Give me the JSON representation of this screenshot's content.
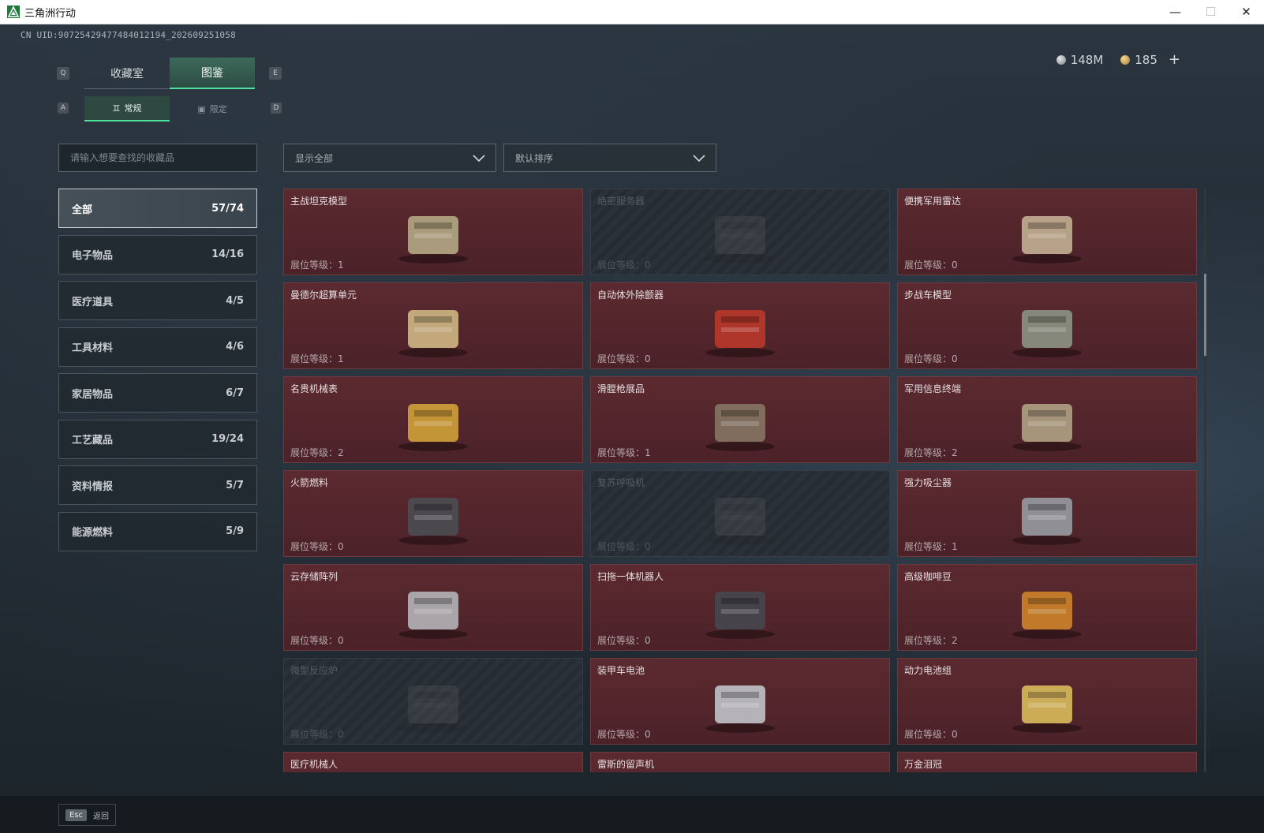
{
  "window": {
    "title": "三角洲行动"
  },
  "uid": "CN UID:9072542947748401219​4_202609251058",
  "currency": {
    "silver": "148M",
    "gold": "185"
  },
  "key_hints": {
    "q": "Q",
    "e": "E",
    "a": "A",
    "d": "D"
  },
  "main_tabs": [
    {
      "label": "收藏室",
      "active": false
    },
    {
      "label": "图鉴",
      "active": true
    }
  ],
  "sub_tabs": [
    {
      "label": "常规",
      "active": true
    },
    {
      "label": "限定",
      "active": false
    }
  ],
  "search": {
    "placeholder": "请输入想要查找的收藏品"
  },
  "filters": {
    "show": "显示全部",
    "sort": "默认排序"
  },
  "categories": [
    {
      "label": "全部",
      "count": "57/74",
      "active": true
    },
    {
      "label": "电子物品",
      "count": "14/16"
    },
    {
      "label": "医疗道具",
      "count": "4/5"
    },
    {
      "label": "工具材料",
      "count": "4/6"
    },
    {
      "label": "家居物品",
      "count": "6/7"
    },
    {
      "label": "工艺藏品",
      "count": "19/24"
    },
    {
      "label": "资料情报",
      "count": "5/7"
    },
    {
      "label": "能源燃料",
      "count": "5/9"
    }
  ],
  "level_label": "展位等级：",
  "items": [
    {
      "name": "主战坦克模型",
      "level": "1",
      "locked": false,
      "icon": "tank-model-icon"
    },
    {
      "name": "绝密服务器",
      "level": "0",
      "locked": true,
      "icon": "server-icon"
    },
    {
      "name": "便携军用雷达",
      "level": "0",
      "locked": false,
      "icon": "radar-icon"
    },
    {
      "name": "曼德尔超算单元",
      "level": "1",
      "locked": false,
      "icon": "cpu-unit-icon"
    },
    {
      "name": "自动体外除颤器",
      "level": "0",
      "locked": false,
      "icon": "defibrillator-icon"
    },
    {
      "name": "步战车模型",
      "level": "0",
      "locked": false,
      "icon": "ifv-model-icon"
    },
    {
      "name": "名贵机械表",
      "level": "2",
      "locked": false,
      "icon": "watch-icon"
    },
    {
      "name": "滑膛枪展品",
      "level": "1",
      "locked": false,
      "icon": "musket-icon"
    },
    {
      "name": "军用信息终端",
      "level": "2",
      "locked": false,
      "icon": "terminal-icon"
    },
    {
      "name": "火箭燃料",
      "level": "0",
      "locked": false,
      "icon": "fuel-can-icon"
    },
    {
      "name": "复苏呼吸机",
      "level": "0",
      "locked": true,
      "icon": "ventilator-icon"
    },
    {
      "name": "强力吸尘器",
      "level": "1",
      "locked": false,
      "icon": "vacuum-icon"
    },
    {
      "name": "云存储阵列",
      "level": "0",
      "locked": false,
      "icon": "storage-array-icon"
    },
    {
      "name": "扫拖一体机器人",
      "level": "0",
      "locked": false,
      "icon": "robot-mop-icon"
    },
    {
      "name": "高级咖啡豆",
      "level": "2",
      "locked": false,
      "icon": "coffee-bag-icon"
    },
    {
      "name": "微型反应炉",
      "level": "0",
      "locked": true,
      "icon": "reactor-icon"
    },
    {
      "name": "装甲车电池",
      "level": "0",
      "locked": false,
      "icon": "battery-icon"
    },
    {
      "name": "动力电池组",
      "level": "0",
      "locked": false,
      "icon": "battery-pack-icon"
    },
    {
      "name": "医疗机械人",
      "level": "",
      "locked": false,
      "icon": "medical-robot-icon"
    },
    {
      "name": "雷斯的留声机",
      "level": "",
      "locked": false,
      "icon": "gramophone-icon"
    },
    {
      "name": "万金泪冠",
      "level": "",
      "locked": false,
      "icon": "crown-icon"
    }
  ],
  "bottom": {
    "esc_key": "Esc",
    "back_label": "返回"
  }
}
